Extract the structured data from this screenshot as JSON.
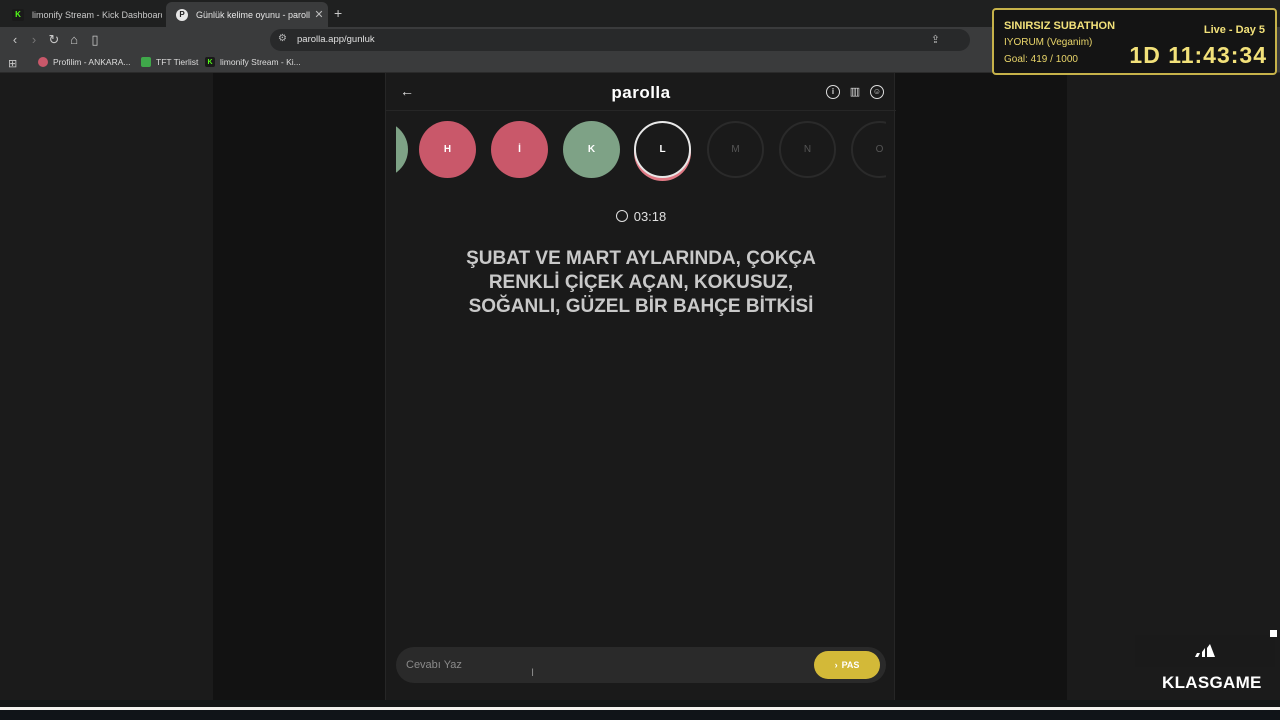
{
  "browser": {
    "tabs": [
      {
        "label": "limonify Stream - Kick Dashboard",
        "favicon": "K",
        "active": false
      },
      {
        "label": "Günlük kelime oyunu - parolla",
        "favicon": "P",
        "active": true
      }
    ],
    "new_tab_icon": "plus-icon",
    "url": "parolla.app/gunluk",
    "bookmarks": [
      {
        "label": "Profilim - ANKARA..."
      },
      {
        "label": "TFT Tierlist"
      },
      {
        "label": "limonify Stream - Ki..."
      }
    ]
  },
  "app": {
    "logo": "parolla",
    "letters": [
      {
        "letter": "",
        "state": "correct"
      },
      {
        "letter": "H",
        "state": "wrong"
      },
      {
        "letter": "İ",
        "state": "wrong"
      },
      {
        "letter": "K",
        "state": "correct"
      },
      {
        "letter": "L",
        "state": "active"
      },
      {
        "letter": "M",
        "state": "pending"
      },
      {
        "letter": "N",
        "state": "pending"
      },
      {
        "letter": "O",
        "state": "pending"
      }
    ],
    "timer": "03:18",
    "question_line1": "ŞUBAT VE MART AYLARINDA, ÇOKÇA",
    "question_line2": "RENKLİ ÇİÇEK AÇAN, KOKUSUZ,",
    "question_line3": "SOĞANLI, GÜZEL BİR BAHÇE BİTKİSİ",
    "answer_placeholder": "Cevabı Yaz",
    "answer_value": "",
    "pass_label": "PAS"
  },
  "overlay": {
    "title": "SINIRSIZ SUBATHON",
    "live": "Live - Day 5",
    "subtitle": "IYORUM (Veganim)",
    "goal": "Goal: 419 / 1000",
    "countdown": "1D 11:43:34",
    "sponsor": "KLASGAME"
  },
  "colors": {
    "correct": "#7ea286",
    "wrong": "#c9586a",
    "pass_button": "#d3b938",
    "overlay_gold": "#f2e17a"
  }
}
